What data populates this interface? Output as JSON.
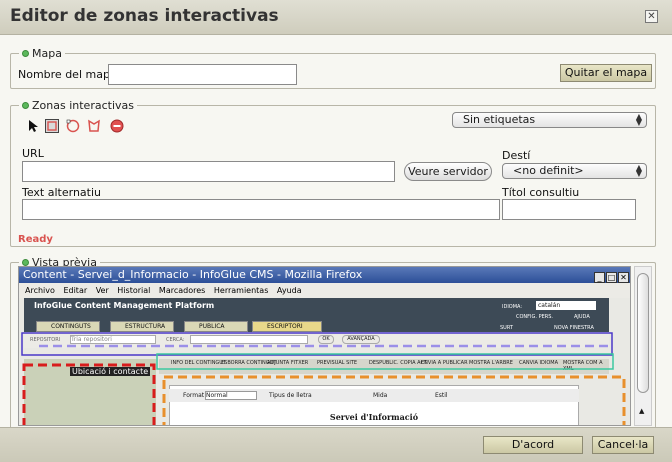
{
  "dialog": {
    "title": "Editor de zonas interactivas",
    "close_icon": "close-icon"
  },
  "mapa": {
    "legend": "Mapa",
    "name_label": "Nombre del mapa",
    "name_value": "",
    "remove_button": "Quitar el mapa"
  },
  "zonas": {
    "legend": "Zonas interactivas",
    "tools": [
      {
        "name": "pointer-tool-icon"
      },
      {
        "name": "rectangle-tool-icon"
      },
      {
        "name": "circle-tool-icon"
      },
      {
        "name": "polygon-tool-icon"
      },
      {
        "name": "delete-zone-icon"
      }
    ],
    "labels_select": "Sin etiquetas",
    "url_label": "URL",
    "url_value": "",
    "browse_button": "Veure servidor",
    "target_label": "Destí",
    "target_value": "<no definit>",
    "alt_label": "Text alternatiu",
    "alt_value": "",
    "tooltip_label": "Títol consultiu",
    "tooltip_value": "",
    "status": "Ready"
  },
  "preview": {
    "legend": "Vista prèvia",
    "window_title": "Content - Servei_d_Informacio - InfoGlue CMS - Mozilla Firefox",
    "menu": [
      "Archivo",
      "Editar",
      "Ver",
      "Historial",
      "Marcadores",
      "Herramientas",
      "Ayuda"
    ],
    "app_title": "InfoGlue Content Management Platform",
    "tabs": [
      "CONTINGUTS",
      "ESTRUCTURA",
      "PUBLICA",
      "ESCRIPTORI"
    ],
    "idioma_label": "IDIOMA:",
    "idioma_value": "catalán",
    "config_label": "CONFIG. PERS.",
    "ajuda_label": "AJUDA",
    "surt_label": "SURT",
    "nova_finestra_label": "NOVA FINESTRA",
    "repositori_label": "REPOSITORI",
    "repositori_value": "Tria repositori",
    "cerca_label": "CERCA:",
    "ok_button": "OK",
    "advanced_button": "AVANÇADA",
    "toolbar_items": [
      "INFO DEL CONTINGUT",
      "ESBORRA CONTINGUT",
      "ADJUNTA FITXER",
      "PREVISUAL SITE",
      "DESPUBLIC. COPIA ACT.",
      "ENVIA A PUBLICAR",
      "MOSTRA L'ARBRE",
      "CANVIA IDIOMA",
      "MOSTRA COM A XML"
    ],
    "tree_item": "Ubicació i contacte",
    "format_label": "Format",
    "format_value": "Normal",
    "font_label": "Tipus de lletra",
    "size_label": "Mida",
    "style_label": "Estil",
    "doc_heading": "Servei d'Informació"
  },
  "buttons": {
    "accept": "D'acord",
    "cancel": "Cancel·la"
  },
  "colors": {
    "accent_green": "#5cb85c",
    "status_red": "#d9534f",
    "window_blue": "#2c4f98"
  }
}
